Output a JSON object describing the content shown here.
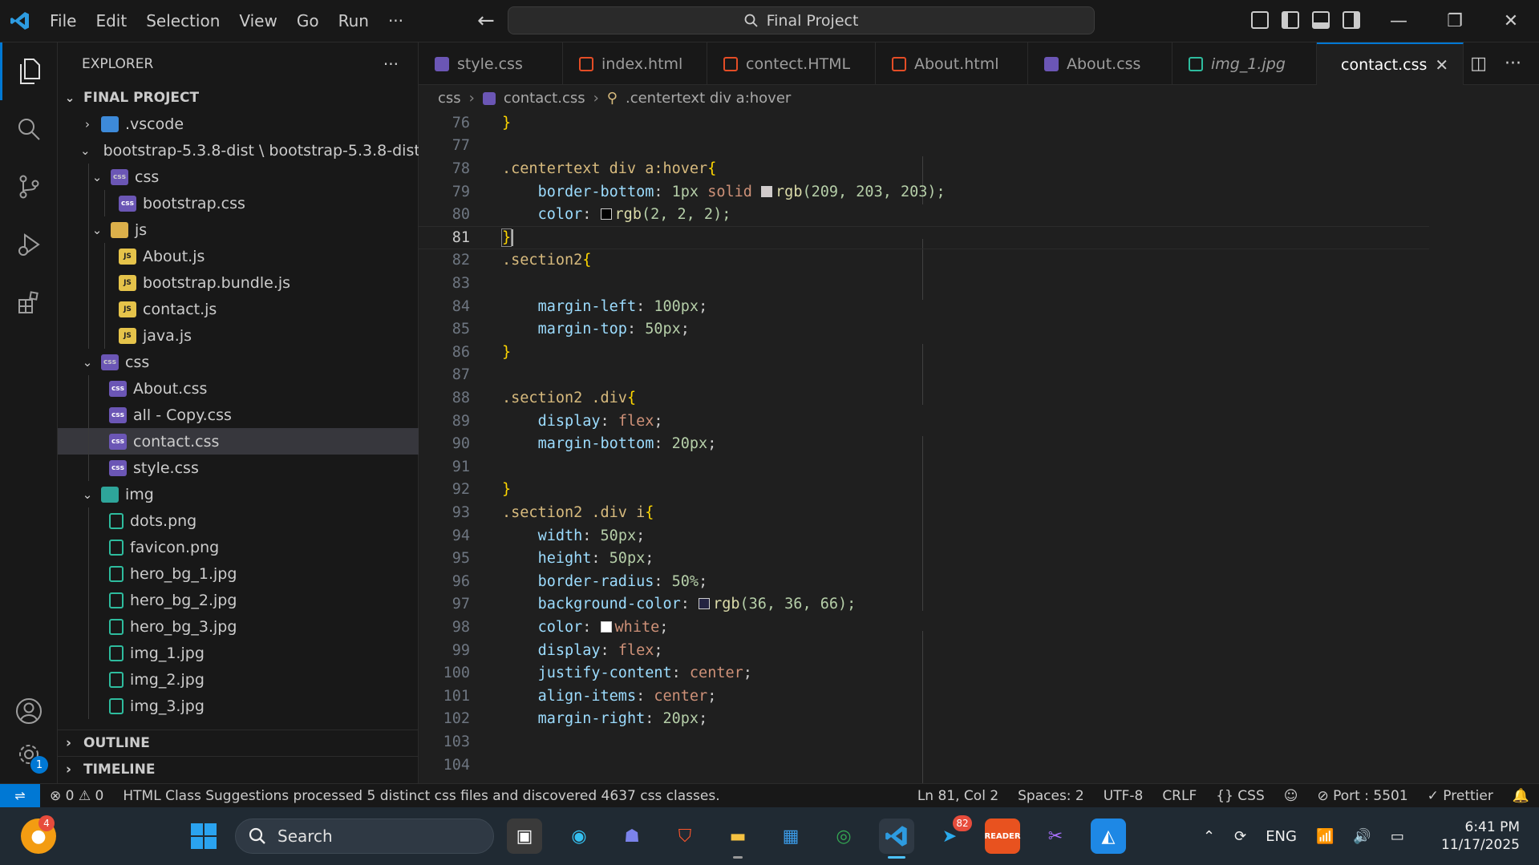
{
  "menu": [
    "File",
    "Edit",
    "Selection",
    "View",
    "Go",
    "Run",
    "···"
  ],
  "search": {
    "label": "Final Project"
  },
  "explorer": {
    "title": "EXPLORER",
    "project": "FINAL PROJECT",
    "items": [
      {
        "label": ".vscode"
      },
      {
        "label": "bootstrap-5.3.8-dist \\ bootstrap-5.3.8-dist"
      },
      {
        "label": "css"
      },
      {
        "label": "bootstrap.css"
      },
      {
        "label": "js"
      },
      {
        "label": "About.js"
      },
      {
        "label": "bootstrap.bundle.js"
      },
      {
        "label": "contact.js"
      },
      {
        "label": "java.js"
      },
      {
        "label": "css"
      },
      {
        "label": "About.css"
      },
      {
        "label": "all - Copy.css"
      },
      {
        "label": "contact.css"
      },
      {
        "label": "style.css"
      },
      {
        "label": "img"
      },
      {
        "label": "dots.png"
      },
      {
        "label": "favicon.png"
      },
      {
        "label": "hero_bg_1.jpg"
      },
      {
        "label": "hero_bg_2.jpg"
      },
      {
        "label": "hero_bg_3.jpg"
      },
      {
        "label": "img_1.jpg"
      },
      {
        "label": "img_2.jpg"
      },
      {
        "label": "img_3.jpg"
      }
    ],
    "outline": "OUTLINE",
    "timeline": "TIMELINE"
  },
  "tabs": [
    {
      "label": "style.css"
    },
    {
      "label": "index.html"
    },
    {
      "label": "contect.HTML"
    },
    {
      "label": "About.html"
    },
    {
      "label": "About.css"
    },
    {
      "label": "img_1.jpg"
    },
    {
      "label": "contact.css"
    }
  ],
  "breadcrumb": {
    "folder": "css",
    "file": "contact.css",
    "symbol": ".centertext div a:hover"
  },
  "editor": {
    "line_numbers": [
      "76",
      "77",
      "78",
      "79",
      "80",
      "81",
      "82",
      "83",
      "84",
      "85",
      "86",
      "87",
      "88",
      "89",
      "90",
      "91",
      "92",
      "93",
      "94",
      "95",
      "96",
      "97",
      "98",
      "99",
      "100",
      "101",
      "102",
      "103",
      "104"
    ],
    "tokens": {
      "l76": "}",
      "l78_sel": ".centertext div a:hover",
      "l78_brace": "{",
      "l79_prop": "border-bottom",
      "l79_val1": "1px",
      "l79_val2": "solid",
      "l79_fn": "rgb",
      "l79_args": "(209, 203, 203);",
      "l80_prop": "color",
      "l80_fn": "rgb",
      "l80_args": "(2, 2, 2);",
      "l81": "}",
      "l82_sel": ".section2",
      "l82_brace": "{",
      "l84_prop": "margin-left",
      "l84_val": "100px",
      "l85_prop": "margin-top",
      "l85_val": "50px",
      "l86": "}",
      "l88_sel": ".section2 .div",
      "l88_brace": "{",
      "l89_prop": "display",
      "l89_val": "flex",
      "l90_prop": "margin-bottom",
      "l90_val": "20px",
      "l92": "}",
      "l93_sel": ".section2 .div i",
      "l93_brace": "{",
      "l94_prop": "width",
      "l94_val": "50px",
      "l95_prop": "height",
      "l95_val": "50px",
      "l96_prop": "border-radius",
      "l96_val": "50%",
      "l97_prop": "background-color",
      "l97_fn": "rgb",
      "l97_args": "(36, 36, 66);",
      "l98_prop": "color",
      "l98_val": "white",
      "l99_prop": "display",
      "l99_val": "flex",
      "l100_prop": "justify-content",
      "l100_val": "center",
      "l101_prop": "align-items",
      "l101_val": "center",
      "l102_prop": "margin-right",
      "l102_val": "20px"
    },
    "swatches": {
      "l79": "#d1cbcb",
      "l80": "#020202",
      "l97": "#242442",
      "l98": "#ffffff"
    }
  },
  "status": {
    "errors": "0",
    "warnings": "0",
    "message": "HTML Class Suggestions processed 5 distinct css files and discovered 4637 css classes.",
    "position": "Ln 81, Col 2",
    "spaces": "Spaces: 2",
    "encoding": "UTF-8",
    "eol": "CRLF",
    "language": "CSS",
    "port": "Port : 5501",
    "prettier": "Prettier"
  },
  "taskbar": {
    "search_placeholder": "Search",
    "language": "ENG",
    "time": "6:41 PM",
    "date": "11/17/2025",
    "badges": {
      "notifications": "4",
      "telegram": "82"
    },
    "reader_label": "READER"
  },
  "settings_badge": "1",
  "colors": {
    "accent": "#0078d4",
    "editor_bg": "#1f1f1f",
    "sidebar_bg": "#181818"
  }
}
